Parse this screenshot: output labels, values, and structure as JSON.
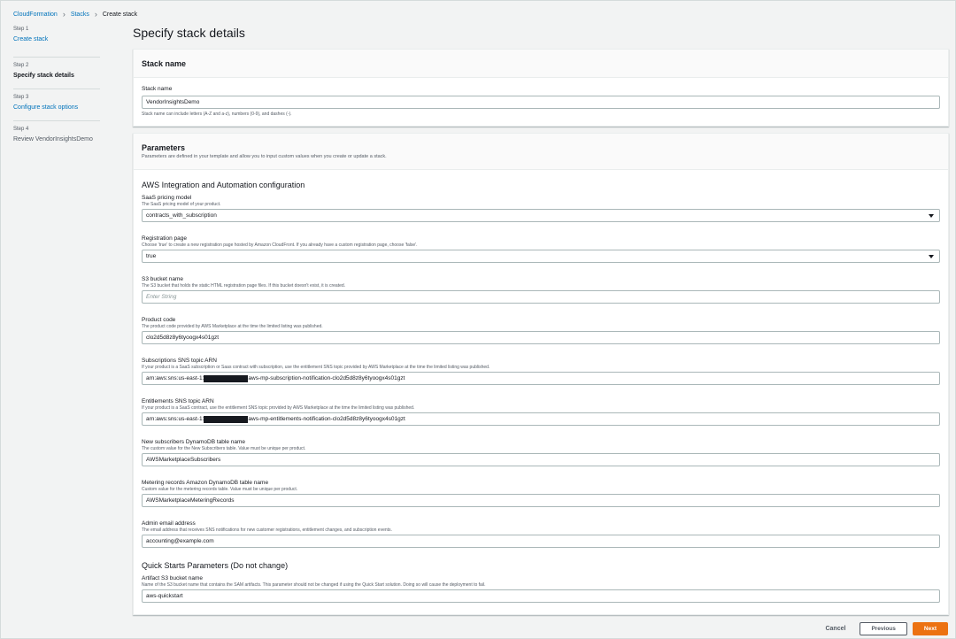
{
  "breadcrumb": {
    "items": [
      "CloudFormation",
      "Stacks"
    ],
    "current": "Create stack"
  },
  "steps": [
    {
      "num": "Step 1",
      "title": "Create stack"
    },
    {
      "num": "Step 2",
      "title": "Specify stack details"
    },
    {
      "num": "Step 3",
      "title": "Configure stack options"
    },
    {
      "num": "Step 4",
      "title": "Review VendorInsightsDemo"
    }
  ],
  "page_title": "Specify stack details",
  "stack_name_panel": {
    "header": "Stack name",
    "label": "Stack name",
    "value": "VendorInsightsDemo",
    "hint": "Stack name can include letters (A-Z and a-z), numbers (0-9), and dashes (-)."
  },
  "parameters_panel": {
    "header": "Parameters",
    "desc": "Parameters are defined in your template and allow you to input custom values when you create or update a stack.",
    "section1_title": "AWS Integration and Automation configuration",
    "fields": {
      "pricing": {
        "label": "SaaS pricing model",
        "desc": "The SaaS pricing model of your product.",
        "value": "contracts_with_subscription"
      },
      "registration": {
        "label": "Registration page",
        "desc": "Choose 'true' to create a new registration page hosted by Amazon CloudFront. If you already have a custom registration page, choose 'false'.",
        "value": "true"
      },
      "s3bucket": {
        "label": "S3 bucket name",
        "desc": "The S3 bucket that holds the static HTML registration page files. If this bucket doesn't exist, it is created.",
        "placeholder": "Enter String"
      },
      "productcode": {
        "label": "Product code",
        "desc": "The product code provided by AWS Marketplace at the time the limited listing was published.",
        "value": "clo2d5d8z8y6tyoogx4s01gzt"
      },
      "subsns": {
        "label": "Subscriptions SNS topic ARN",
        "desc": "If your product is a SaaS subscription or Saas contract with subscription, use the entitlement SNS topic provided by AWS Marketplace at the time the limited listing was published.",
        "prefix": "arn:aws:sns:us-east-1:",
        "suffix": "aws-mp-subscription-notification-clo2d5d8z8y6tyoogx4s01gzt"
      },
      "entsns": {
        "label": "Entitlements SNS topic ARN",
        "desc": "If your product is a SaaS contract, use the entitlement SNS topic provided by AWS Marketplace at the time the limited listing was published.",
        "prefix": "arn:aws:sns:us-east-1:",
        "suffix": "aws-mp-entitlements-notification-clo2d5d8z8y6tyoogx4s01gzt"
      },
      "subtable": {
        "label": "New subscribers DynamoDB table name",
        "desc": "The custom value for the New Subscribers table. Value must be unique per product.",
        "value": "AWSMarketplaceSubscribers"
      },
      "metertable": {
        "label": "Metering records Amazon DynamoDB table name",
        "desc": "Custom value for the metering records table. Value must be unique per product.",
        "value": "AWSMarketplaceMeteringRecords"
      },
      "email": {
        "label": "Admin email address",
        "desc": "The email address that receives SNS notifications for new customer registrations, entitlement changes, and subscription events.",
        "value": "accounting@example.com"
      }
    },
    "section2_title": "Quick Starts Parameters (Do not change)",
    "artifact": {
      "label": "Artifact S3 bucket name",
      "desc": "Name of the S3 bucket name that contains the SAM artifacts. This parameter should not be changed if using the Quick Start solution. Doing so will cause the deployment to fail.",
      "value": "aws-quickstart"
    }
  },
  "footer": {
    "cancel": "Cancel",
    "previous": "Previous",
    "next": "Next"
  },
  "colors": {
    "link": "#0073bb",
    "primary": "#ec7211",
    "background": "#f2f3f3"
  }
}
